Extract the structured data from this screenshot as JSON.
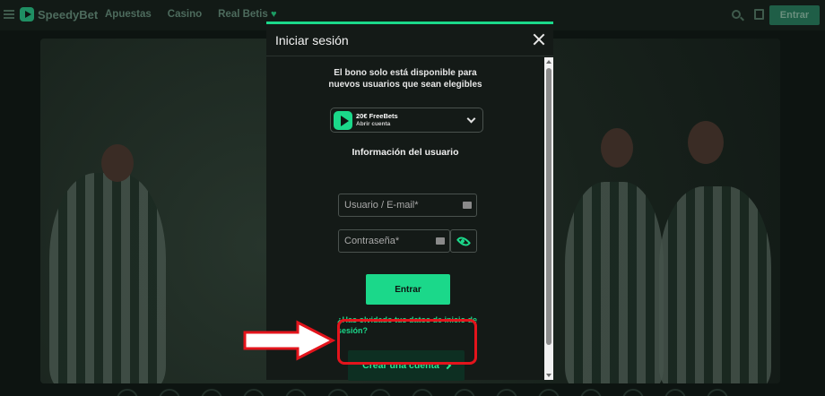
{
  "header": {
    "brand": "SpeedyBet",
    "nav": [
      "Apuestas",
      "Casino",
      "Real Betis"
    ],
    "nav_heart": "♥",
    "login_label": "Entrar"
  },
  "modal": {
    "title": "Iniciar sesión",
    "notice": "El bono solo está disponible para nuevos usuarios que sean elegibles",
    "bonus": {
      "title": "20€ FreeBets",
      "subtitle": "Abrir cuenta"
    },
    "section_title": "Información del usuario",
    "username_placeholder": "Usuario / E-mail*",
    "password_placeholder": "Contraseña*",
    "login_button": "Entrar",
    "forgot_link": "¿Has olvidado tus datos de inicio de sesión?",
    "create_account_button": "Crear una cuenta"
  },
  "colors": {
    "accent": "#1bd88a",
    "highlight": "#e3141c",
    "modal_bg": "#141a17"
  }
}
